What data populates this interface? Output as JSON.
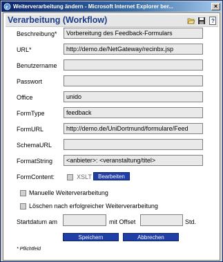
{
  "window": {
    "title": "Weiterverarbeitung ändern - Microsoft Internet Explorer ber..."
  },
  "header": {
    "title": "Verarbeitung (Workflow)",
    "icons": [
      "folder-open-icon",
      "save-icon",
      "help-icon"
    ]
  },
  "fields": [
    {
      "label": "Beschreibung*",
      "value": "Vorbereitung des Feedback-Formulars"
    },
    {
      "label": "URL*",
      "value": "http://demo.de/NetGateway/recinbx.jsp"
    },
    {
      "label": "Benutzername",
      "value": ""
    },
    {
      "label": "Passwort",
      "value": ""
    },
    {
      "label": "Office",
      "value": "unido"
    },
    {
      "label": "FormType",
      "value": "feedback"
    },
    {
      "label": "FormURL",
      "value": "http://demo.de/UniDortmund/formulare/Feed"
    },
    {
      "label": "SchemaURL",
      "value": ""
    },
    {
      "label": "FormatString",
      "value": "<anbieter>: <veranstaltung/titel>"
    }
  ],
  "formcontent": {
    "label": "FormContent:",
    "xslt_label": "XSLT",
    "edit_button": "Bearbeiten"
  },
  "checkboxes": [
    {
      "label": "Manuelle Weiterverarbeitung",
      "checked": false
    },
    {
      "label": "Löschen nach erfolgreicher Weiterverarbeitung",
      "checked": false
    }
  ],
  "start": {
    "label": "Startdatum am",
    "offset_label": "mit Offset",
    "unit": "Std.",
    "date_value": "",
    "offset_value": ""
  },
  "buttons": {
    "save": "Speichern",
    "cancel": "Abbrechen"
  },
  "required_note": "* Pflichtfeld"
}
